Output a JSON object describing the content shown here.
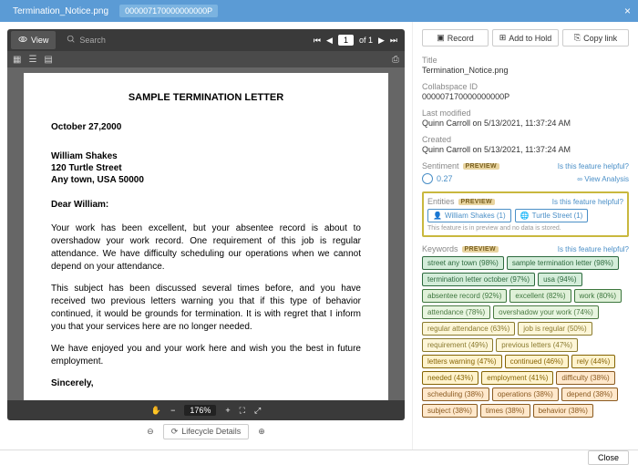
{
  "titlebar": {
    "filename": "Termination_Notice.png",
    "tag": "000007170000000000P"
  },
  "toolbar": {
    "view": "View",
    "search": "Search",
    "page_current": "1",
    "page_of": "of 1"
  },
  "zoom": {
    "level": "176%"
  },
  "bottombar": {
    "lifecycle": "Lifecycle Details"
  },
  "document": {
    "title": "SAMPLE TERMINATION LETTER",
    "date": "October 27,2000",
    "addr_name": "William Shakes",
    "addr_street": "120 Turtle Street",
    "addr_city": "Any town, USA 50000",
    "salutation": "Dear William:",
    "para1": "Your work has been excellent, but your absentee record is about to overshadow your work record.  One requirement of this job is regular attendance.  We have difficulty scheduling our operations when we cannot depend on your attendance.",
    "para2": "This subject has been discussed several times before, and you have received two previous letters warning you that if this type of behavior continued, it would be grounds for termination.  It is with regret that I inform you that your services here are no longer needed.",
    "para3": "We have enjoyed you and your work here and wish you the best in future employment.",
    "closing": "Sincerely,"
  },
  "actions": {
    "record": "Record",
    "addhold": "Add to Hold",
    "copylink": "Copy link"
  },
  "meta": {
    "title_label": "Title",
    "title_value": "Termination_Notice.png",
    "cid_label": "Collabspace ID",
    "cid_value": "000007170000000000P",
    "lm_label": "Last modified",
    "lm_value": "Quinn Carroll on 5/13/2021, 11:37:24 AM",
    "cr_label": "Created",
    "cr_value": "Quinn Carroll on 5/13/2021, 11:37:24 AM"
  },
  "sentiment": {
    "label": "Sentiment",
    "preview": "PREVIEW",
    "helpful": "Is this feature helpful?",
    "score": "0.27",
    "view_analysis": "View Analysis"
  },
  "entities": {
    "label": "Entities",
    "preview": "PREVIEW",
    "helpful": "Is this feature helpful?",
    "e1": "William Shakes (1)",
    "e2": "Turtle Street (1)",
    "disclaimer": "This feature is in preview and no data is stored."
  },
  "keywords": {
    "label": "Keywords",
    "preview": "PREVIEW",
    "helpful": "Is this feature helpful?",
    "k1": "street any town (98%)",
    "k2": "sample termination letter (98%)",
    "k3": "termination letter october (97%)",
    "k4": "usa (94%)",
    "k5": "absentee record (92%)",
    "k6": "excellent (82%)",
    "k7": "work (80%)",
    "k8": "attendance (78%)",
    "k9": "overshadow your work (74%)",
    "k10": "regular attendance (63%)",
    "k11": "job is regular (50%)",
    "k12": "requirement (49%)",
    "k13": "previous letters (47%)",
    "k14": "letters warning (47%)",
    "k15": "continued (46%)",
    "k16": "rely (44%)",
    "k17": "needed (43%)",
    "k18": "employment (41%)",
    "k19": "difficulty (38%)",
    "k20": "scheduling (38%)",
    "k21": "operations (38%)",
    "k22": "depend (38%)",
    "k23": "subject (38%)",
    "k24": "times (38%)",
    "k25": "behavior (38%)"
  },
  "footer": {
    "close": "Close"
  }
}
